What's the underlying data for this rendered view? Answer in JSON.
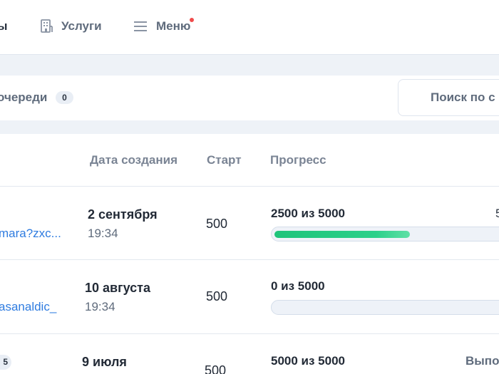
{
  "nav": {
    "cut_item": "ы",
    "services_label": "Услуги",
    "menu_label": "Меню"
  },
  "toolbar": {
    "queue_label": "очереди",
    "queue_count": "0",
    "search_placeholder": "Поиск по с"
  },
  "table": {
    "headers": {
      "created": "Дата создания",
      "start": "Старт",
      "progress": "Прогресс"
    },
    "rows": [
      {
        "link": "mara?zxc...",
        "date": "2 сентября",
        "time": "19:34",
        "start": "500",
        "progress_text": "2500 из 5000",
        "progress": 0.5,
        "edge": "5"
      },
      {
        "link": "asanaldic_",
        "date": "10 августа",
        "time": "19:34",
        "start": "500",
        "progress_text": "0 из 5000",
        "progress": 0
      },
      {
        "badge": "5",
        "date": "9 июля",
        "start": "500",
        "progress_text": "5000 из 5000",
        "status": "Выпо"
      }
    ]
  },
  "colors": {
    "link": "#2f7ce0",
    "progress": "#1ec47a",
    "notification": "#f04b4b"
  }
}
